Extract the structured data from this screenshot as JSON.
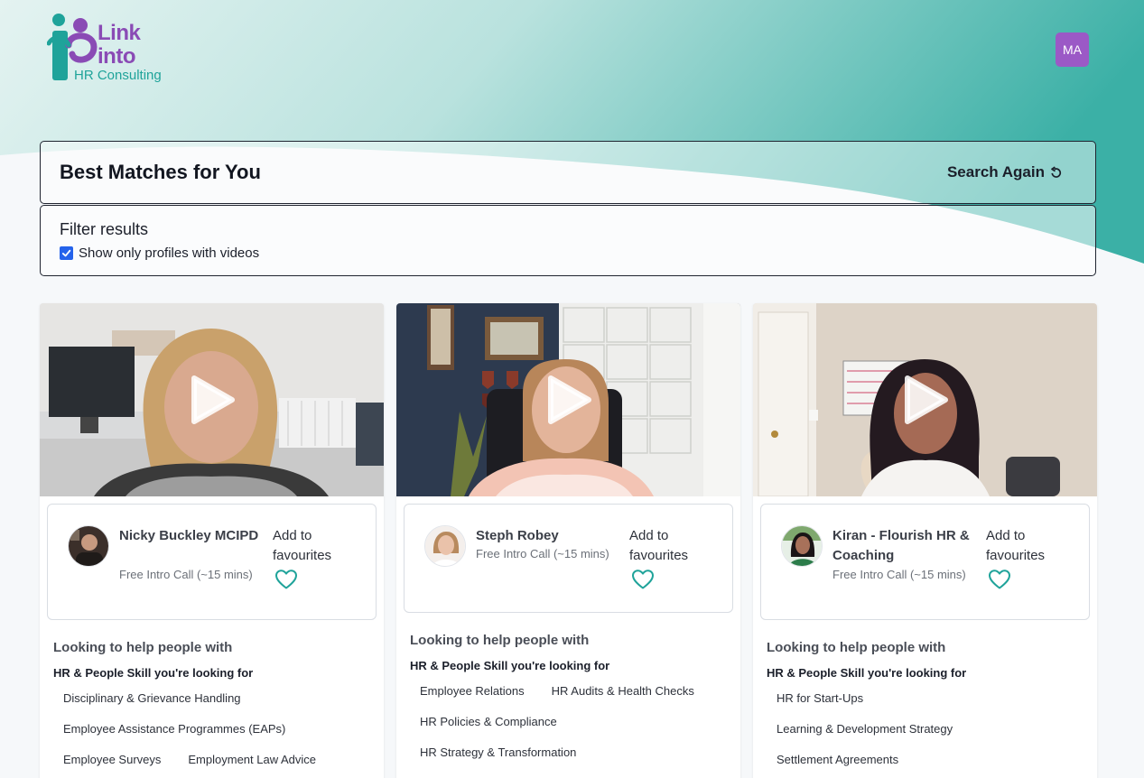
{
  "brand": {
    "logo_line1": "Link",
    "logo_line2": "into",
    "logo_line3": "HR Consulting",
    "teal": "#1fa39a",
    "purple": "#8a4bb5"
  },
  "header": {
    "user_initials": "MA"
  },
  "matches": {
    "title": "Best Matches for You",
    "search_again": "Search Again",
    "search_icon": "refresh-icon"
  },
  "filter": {
    "title": "Filter results",
    "checkbox_label": "Show only profiles with videos",
    "checked": true
  },
  "cards": [
    {
      "name": "Nicky Buckley MCIPD",
      "tag": "Free Intro Call (~15 mins)",
      "fav_label": "Add to favourites",
      "help_title": "Looking to help people with",
      "skill_title": "HR & People Skill you're looking for",
      "skills": [
        "Disciplinary & Grievance Handling",
        "Employee Assistance Programmes (EAPs)",
        "Employee Surveys",
        "Employment Law Advice"
      ]
    },
    {
      "name": "Steph Robey",
      "tag": "Free Intro Call (~15 mins)",
      "fav_label": "Add to favourites",
      "help_title": "Looking to help people with",
      "skill_title": "HR & People Skill you're looking for",
      "skills": [
        "Employee Relations",
        "HR Audits & Health Checks",
        "HR Policies & Compliance",
        "HR Strategy & Transformation"
      ]
    },
    {
      "name": "Kiran - Flourish HR & Coaching",
      "tag": "Free Intro Call (~15 mins)",
      "fav_label": "Add to favourites",
      "help_title": "Looking to help people with",
      "skill_title": "HR & People Skill you're looking for",
      "skills": [
        "HR for Start-Ups",
        "Learning & Development Strategy",
        "Settlement Agreements"
      ]
    }
  ]
}
